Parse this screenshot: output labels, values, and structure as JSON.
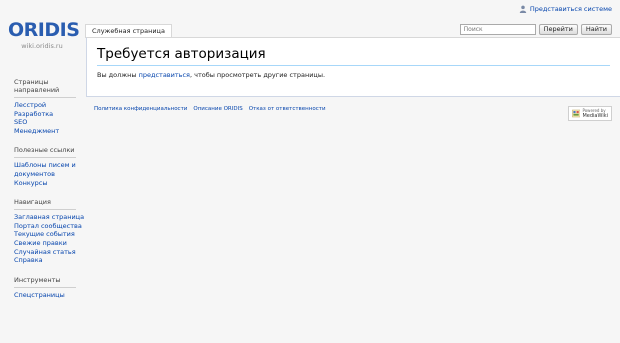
{
  "personal": {
    "login_label": "Представиться системе"
  },
  "logo": {
    "brand": "ORIDIS",
    "subtitle": "wiki.oridis.ru"
  },
  "tabs": [
    {
      "label": "Служебная страница"
    }
  ],
  "search": {
    "placeholder": "Поиск",
    "go_label": "Перейти",
    "search_label": "Найти"
  },
  "content": {
    "heading": "Требуется авторизация",
    "text_before": "Вы должны ",
    "link": "представиться",
    "text_after": ", чтобы просмотреть другие страницы."
  },
  "sidebar": [
    {
      "title": "Страницы направлений",
      "items": [
        "Лесстрой",
        "Разработка",
        "SEO",
        "Менеджмент"
      ]
    },
    {
      "title": "Полезные ссылки",
      "items": [
        "Шаблоны писем и документов",
        "Конкурсы"
      ]
    },
    {
      "title": "Навигация",
      "items": [
        "Заглавная страница",
        "Портал сообщества",
        "Текущие события",
        "Свежие правки",
        "Случайная статья",
        "Справка"
      ]
    },
    {
      "title": "Инструменты",
      "items": [
        "Спецстраницы"
      ]
    }
  ],
  "footer": {
    "links": [
      "Политика конфиденциальности",
      "Описание ORIDIS",
      "Отказ от ответственности"
    ]
  },
  "powered": {
    "line1": "Powered by",
    "line2": "MediaWiki"
  },
  "colors": {
    "link": "#0645ad",
    "brand": "#2a5db0",
    "heading_rule": "#a7d7f9"
  }
}
